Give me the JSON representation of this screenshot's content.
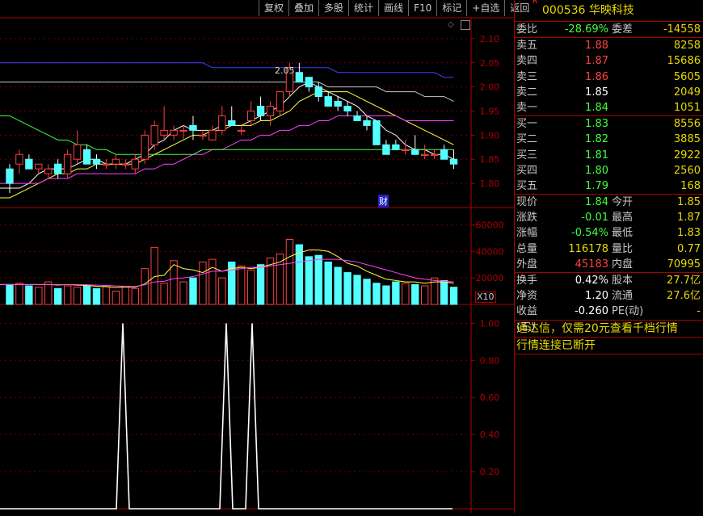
{
  "toolbar": {
    "buttons": [
      "复权",
      "叠加",
      "多股",
      "统计",
      "画线",
      "F10",
      "标记",
      "+自选",
      "返回"
    ]
  },
  "stock": {
    "flag": "R",
    "code": "000536",
    "name": "华映科技"
  },
  "weibi": {
    "label": "委比",
    "value": "-28.69%",
    "label2": "委差",
    "value2": "-14558"
  },
  "asks": [
    {
      "label": "卖五",
      "price": "1.88",
      "vol": "8258"
    },
    {
      "label": "卖四",
      "price": "1.87",
      "vol": "15686"
    },
    {
      "label": "卖三",
      "price": "1.86",
      "vol": "5605"
    },
    {
      "label": "卖二",
      "price": "1.85",
      "vol": "2049"
    },
    {
      "label": "卖一",
      "price": "1.84",
      "vol": "1051"
    }
  ],
  "bids": [
    {
      "label": "买一",
      "price": "1.83",
      "vol": "8556"
    },
    {
      "label": "买二",
      "price": "1.82",
      "vol": "3885"
    },
    {
      "label": "买三",
      "price": "1.81",
      "vol": "2922"
    },
    {
      "label": "买四",
      "price": "1.80",
      "vol": "2560"
    },
    {
      "label": "买五",
      "price": "1.79",
      "vol": "168"
    }
  ],
  "quote": [
    {
      "l1": "现价",
      "v1": "1.84",
      "l2": "今开",
      "v2": "1.85"
    },
    {
      "l1": "涨跌",
      "v1": "-0.01",
      "l2": "最高",
      "v2": "1.87"
    },
    {
      "l1": "涨幅",
      "v1": "-0.54%",
      "l2": "最低",
      "v2": "1.83"
    },
    {
      "l1": "总量",
      "v1": "116178",
      "l2": "量比",
      "v2": "0.77"
    },
    {
      "l1": "外盘",
      "v1": "45183",
      "l2": "内盘",
      "v2": "70995"
    }
  ],
  "fin": [
    {
      "l1": "换手",
      "v1": "0.42%",
      "l2": "股本",
      "v2": "27.7亿"
    },
    {
      "l1": "净资",
      "v1": "1.20",
      "l2": "流通",
      "v2": "27.6亿"
    },
    {
      "l1": "收益(三)",
      "v1": "-0.260",
      "l2": "PE(动)",
      "v2": "-"
    }
  ],
  "messages": {
    "line1": "通达信，仅需20元查看千档行情",
    "line2": "行情连接已断开"
  },
  "chart_labels": {
    "peak": "2.05",
    "cai": "财",
    "x10": "X10"
  },
  "colors": {
    "up": "#ff4040",
    "down": "#54ffff",
    "ma5": "#ffffff",
    "ma10": "#ffff40",
    "ma20": "#ff40ff",
    "ma60": "#40ff40",
    "ma_slow1": "#c8c8c8",
    "ma_slow2": "#4040ff"
  },
  "chart_data": [
    {
      "type": "candlestick",
      "ylim": [
        1.77,
        2.13
      ],
      "y_ticks": [
        "2.10",
        "2.05",
        "2.00",
        "1.95",
        "1.90",
        "1.85",
        "1.80"
      ],
      "ohlc": [
        [
          1.83,
          1.84,
          1.78,
          1.8
        ],
        [
          1.84,
          1.87,
          1.82,
          1.86
        ],
        [
          1.85,
          1.86,
          1.83,
          1.83
        ],
        [
          1.83,
          1.84,
          1.82,
          1.84
        ],
        [
          1.82,
          1.84,
          1.81,
          1.83
        ],
        [
          1.84,
          1.85,
          1.81,
          1.82
        ],
        [
          1.82,
          1.87,
          1.81,
          1.86
        ],
        [
          1.85,
          1.91,
          1.84,
          1.88
        ],
        [
          1.87,
          1.88,
          1.84,
          1.84
        ],
        [
          1.85,
          1.86,
          1.83,
          1.84
        ],
        [
          1.84,
          1.85,
          1.83,
          1.84
        ],
        [
          1.84,
          1.86,
          1.83,
          1.85
        ],
        [
          1.84,
          1.85,
          1.83,
          1.84
        ],
        [
          1.83,
          1.86,
          1.82,
          1.85
        ],
        [
          1.85,
          1.91,
          1.84,
          1.9
        ],
        [
          1.88,
          1.93,
          1.87,
          1.92
        ],
        [
          1.9,
          1.96,
          1.89,
          1.91
        ],
        [
          1.9,
          1.92,
          1.89,
          1.91
        ],
        [
          1.91,
          1.92,
          1.89,
          1.91
        ],
        [
          1.92,
          1.94,
          1.89,
          1.91
        ],
        [
          1.9,
          1.91,
          1.89,
          1.9
        ],
        [
          1.89,
          1.92,
          1.89,
          1.91
        ],
        [
          1.91,
          1.96,
          1.9,
          1.94
        ],
        [
          1.93,
          1.96,
          1.92,
          1.92
        ],
        [
          1.91,
          1.92,
          1.9,
          1.91
        ],
        [
          1.93,
          1.97,
          1.92,
          1.95
        ],
        [
          1.96,
          1.98,
          1.93,
          1.94
        ],
        [
          1.94,
          1.97,
          1.92,
          1.96
        ],
        [
          1.95,
          1.99,
          1.94,
          1.99
        ],
        [
          1.99,
          2.05,
          1.98,
          2.04
        ],
        [
          2.03,
          2.05,
          2.01,
          2.01
        ],
        [
          2.02,
          2.02,
          1.99,
          2.0
        ],
        [
          2.0,
          2.01,
          1.97,
          1.98
        ],
        [
          1.98,
          1.99,
          1.96,
          1.96
        ],
        [
          1.97,
          1.98,
          1.95,
          1.96
        ],
        [
          1.96,
          1.97,
          1.94,
          1.95
        ],
        [
          1.94,
          1.95,
          1.93,
          1.93
        ],
        [
          1.93,
          1.94,
          1.91,
          1.92
        ],
        [
          1.93,
          1.93,
          1.88,
          1.88
        ],
        [
          1.88,
          1.89,
          1.86,
          1.86
        ],
        [
          1.88,
          1.89,
          1.87,
          1.87
        ],
        [
          1.87,
          1.89,
          1.86,
          1.87
        ],
        [
          1.87,
          1.9,
          1.86,
          1.86
        ],
        [
          1.86,
          1.88,
          1.85,
          1.86
        ],
        [
          1.86,
          1.87,
          1.85,
          1.86
        ],
        [
          1.87,
          1.88,
          1.85,
          1.85
        ],
        [
          1.85,
          1.87,
          1.83,
          1.84
        ]
      ],
      "ma_series": [
        {
          "values": [
            1.79,
            1.79,
            1.8,
            1.82,
            1.83,
            1.83,
            1.83,
            1.84,
            1.85,
            1.85,
            1.84,
            1.84,
            1.84,
            1.85,
            1.86,
            1.88,
            1.89,
            1.91,
            1.92,
            1.91,
            1.91,
            1.91,
            1.92,
            1.92,
            1.92,
            1.93,
            1.94,
            1.95,
            1.96,
            1.98,
            2.0,
            2.01,
            2.0,
            1.99,
            1.98,
            1.97,
            1.96,
            1.94,
            1.93,
            1.91,
            1.9,
            1.88,
            1.87,
            1.87,
            1.86,
            1.86,
            1.85
          ]
        },
        {
          "values": [
            1.77,
            1.78,
            1.79,
            1.8,
            1.81,
            1.82,
            1.82,
            1.83,
            1.83,
            1.84,
            1.84,
            1.84,
            1.84,
            1.84,
            1.85,
            1.86,
            1.87,
            1.88,
            1.89,
            1.9,
            1.9,
            1.91,
            1.91,
            1.92,
            1.92,
            1.92,
            1.93,
            1.93,
            1.94,
            1.95,
            1.97,
            1.98,
            1.99,
            1.99,
            1.99,
            1.99,
            1.98,
            1.97,
            1.96,
            1.95,
            1.94,
            1.93,
            1.92,
            1.91,
            1.9,
            1.89,
            1.88
          ]
        },
        {
          "values": [
            1.8,
            1.8,
            1.8,
            1.8,
            1.81,
            1.81,
            1.81,
            1.82,
            1.82,
            1.82,
            1.82,
            1.82,
            1.82,
            1.82,
            1.83,
            1.83,
            1.84,
            1.84,
            1.85,
            1.86,
            1.86,
            1.87,
            1.87,
            1.88,
            1.89,
            1.89,
            1.9,
            1.9,
            1.91,
            1.91,
            1.92,
            1.92,
            1.93,
            1.93,
            1.94,
            1.94,
            1.94,
            1.94,
            1.94,
            1.94,
            1.94,
            1.93,
            1.93,
            1.93,
            1.93,
            1.93,
            1.93
          ]
        },
        {
          "values": [
            1.94,
            1.93,
            1.92,
            1.91,
            1.9,
            1.89,
            1.89,
            1.88,
            1.88,
            1.87,
            1.87,
            1.86,
            1.86,
            1.86,
            1.86,
            1.86,
            1.86,
            1.86,
            1.86,
            1.86,
            1.87,
            1.87,
            1.87,
            1.87,
            1.87,
            1.87,
            1.87,
            1.87,
            1.87,
            1.87,
            1.87,
            1.87,
            1.87,
            1.87,
            1.87,
            1.87,
            1.87,
            1.87,
            1.87,
            1.87,
            1.87,
            1.87,
            1.87,
            1.87,
            1.87,
            1.87,
            1.87
          ]
        },
        {
          "values": [
            2.01,
            2.01,
            2.01,
            2.01,
            2.01,
            2.01,
            2.01,
            2.01,
            2.01,
            2.01,
            2.01,
            2.01,
            2.01,
            2.01,
            2.01,
            2.01,
            2.01,
            2.01,
            2.01,
            2.01,
            2.01,
            2.01,
            2.01,
            2.01,
            2.01,
            2.01,
            2.01,
            2.01,
            2.01,
            2.01,
            2.01,
            2.01,
            2.01,
            2.0,
            2.0,
            2.0,
            2.0,
            2.0,
            2.0,
            1.99,
            1.99,
            1.99,
            1.99,
            1.98,
            1.98,
            1.98,
            1.97
          ]
        },
        {
          "values": [
            2.05,
            2.05,
            2.05,
            2.05,
            2.05,
            2.05,
            2.05,
            2.05,
            2.05,
            2.05,
            2.05,
            2.05,
            2.05,
            2.05,
            2.05,
            2.05,
            2.05,
            2.05,
            2.05,
            2.05,
            2.05,
            2.04,
            2.04,
            2.04,
            2.04,
            2.04,
            2.04,
            2.04,
            2.04,
            2.04,
            2.04,
            2.04,
            2.04,
            2.04,
            2.03,
            2.03,
            2.03,
            2.03,
            2.03,
            2.03,
            2.03,
            2.03,
            2.03,
            2.03,
            2.03,
            2.02,
            2.02
          ]
        }
      ]
    },
    {
      "type": "bar",
      "title": "",
      "ylim": [
        0,
        70000
      ],
      "y_ticks": [
        "60000",
        "40000",
        "20000"
      ],
      "values": [
        15000,
        16000,
        14000,
        13000,
        17000,
        12000,
        14000,
        13000,
        14000,
        12000,
        14000,
        10000,
        13000,
        12000,
        27000,
        43000,
        16000,
        33000,
        17000,
        20000,
        32000,
        34000,
        20000,
        32000,
        29000,
        26000,
        30000,
        35000,
        38000,
        49000,
        45000,
        36000,
        37000,
        32000,
        28000,
        24000,
        22000,
        19000,
        16000,
        14000,
        17000,
        16000,
        15000,
        14000,
        20000,
        18000,
        13000
      ],
      "ma_series": [
        {
          "values": [
            15000,
            15000,
            15000,
            15000,
            15000,
            14600,
            15000,
            14500,
            14300,
            13700,
            13400,
            12800,
            13300,
            12900,
            15400,
            21000,
            22000,
            30000,
            27000,
            26000,
            24000,
            28000,
            25000,
            27000,
            28000,
            27000,
            28000,
            30000,
            32000,
            36000,
            39000,
            41000,
            41000,
            40000,
            36000,
            31000,
            29000,
            25000,
            22000,
            19000,
            18000,
            17000,
            17000,
            16000,
            17000,
            17000,
            16000
          ]
        },
        {
          "values": [
            15000,
            15000,
            15000,
            15000,
            15000,
            15000,
            15000,
            15000,
            14800,
            14500,
            14300,
            13900,
            13700,
            13500,
            14800,
            17000,
            17400,
            19500,
            20000,
            21000,
            23000,
            25000,
            25000,
            26000,
            27000,
            28000,
            28000,
            29000,
            30000,
            31000,
            32000,
            33000,
            34000,
            34000,
            34000,
            33000,
            32000,
            30000,
            28000,
            26000,
            24000,
            22000,
            20000,
            19000,
            18000,
            17500,
            17000
          ]
        }
      ]
    },
    {
      "type": "line",
      "title": "",
      "ylim": [
        0,
        1.08
      ],
      "y_ticks": [
        "1.00",
        "0.80",
        "0.60",
        "0.40",
        "0.20"
      ],
      "values": [
        0,
        0,
        0,
        0,
        0,
        0,
        0,
        0,
        0,
        0,
        0,
        0,
        0,
        0,
        0,
        0,
        0,
        0,
        0,
        1,
        0,
        0,
        0,
        0,
        0,
        0,
        0,
        0,
        0,
        0,
        0,
        0,
        0,
        0,
        0,
        1,
        0,
        0,
        0,
        1,
        0,
        0,
        0,
        0,
        0,
        0,
        0,
        0,
        0,
        0,
        0,
        0,
        0,
        0,
        0,
        0,
        0,
        0,
        0,
        0,
        0,
        0,
        0,
        0,
        0,
        0,
        0,
        0,
        0,
        0,
        0
      ]
    }
  ]
}
